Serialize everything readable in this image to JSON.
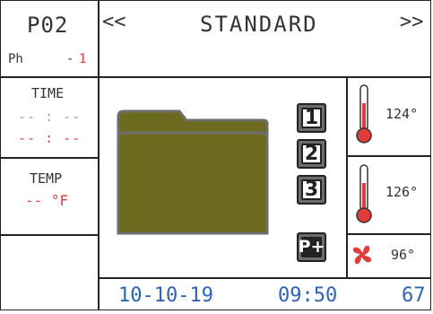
{
  "program": {
    "code": "P02",
    "phase_label": "Ph",
    "phase_sep": "-",
    "phase_value": "1"
  },
  "header": {
    "prev_arrow": "<<",
    "mode": "STANDARD",
    "next_arrow": ">>"
  },
  "time_panel": {
    "label": "TIME",
    "line1": "-- : --",
    "line2": "-- : --"
  },
  "temp_panel": {
    "label": "TEMP",
    "value": "-- °F"
  },
  "keys": [
    "1",
    "2",
    "3",
    "P+"
  ],
  "sensors": [
    {
      "icon": "thermometer-icon",
      "value": "124°"
    },
    {
      "icon": "thermometer-icon",
      "value": "126°"
    },
    {
      "icon": "fan-icon",
      "value": "96°"
    }
  ],
  "footer": {
    "date": "10-10-19",
    "time": "09:50",
    "number": "67"
  },
  "colors": {
    "accent_red": "#e23b3b",
    "accent_blue": "#2c63b5",
    "folder": "#6b6a1f"
  }
}
